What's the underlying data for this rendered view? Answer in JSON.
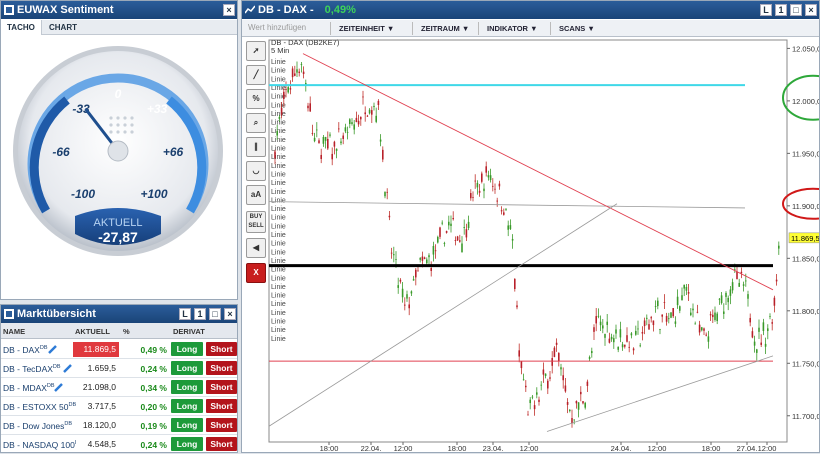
{
  "sentiment": {
    "title": "EUWAX Sentiment",
    "tabs": [
      "TACHO",
      "CHART"
    ],
    "gauge_labels": {
      "zero": "0",
      "m33": "-33",
      "p33": "+33",
      "m66": "-66",
      "p66": "+66",
      "m100": "-100",
      "p100": "+100"
    },
    "aktuell_label": "AKTUELL",
    "aktuell_value": "-27,87",
    "needle_value": -27.87
  },
  "market": {
    "title": "Marktübersicht",
    "headers": {
      "name": "NAME",
      "aktuell": "AKTUELL",
      "pct": "%",
      "derivat": "DERIVAT"
    },
    "long_label": "Long",
    "short_label": "Short",
    "rows": [
      {
        "name": "DB - DAX",
        "sup": "DB",
        "price": "11.869,5",
        "pct": "0,49 %",
        "neg": true
      },
      {
        "name": "DB - TecDAX",
        "sup": "DB",
        "price": "1.659,5",
        "pct": "0,24 %",
        "neg": false
      },
      {
        "name": "DB - MDAX",
        "sup": "DB",
        "price": "21.098,0",
        "pct": "0,34 %",
        "neg": false
      },
      {
        "name": "DB - ESTOXX 50",
        "sup": "DB",
        "price": "3.717,5",
        "pct": "0,20 %",
        "neg": false
      },
      {
        "name": "DB - Dow Jones",
        "sup": "DB",
        "price": "18.120,0",
        "pct": "0,19 %",
        "neg": false
      },
      {
        "name": "DB - NASDAQ 100",
        "sup": "I",
        "price": "4.548,5",
        "pct": "0,24 %",
        "neg": false
      }
    ]
  },
  "chart": {
    "title": "DB - DAX -",
    "change": "0,49%",
    "add_value_placeholder": "Wert hinzufügen",
    "menus": [
      "ZEITEINHEIT",
      "ZEITRAUM",
      "INDIKATOR",
      "SCANS"
    ],
    "symbol": "DB - DAX (DB2KE7)",
    "interval": "5 Min",
    "linie_label": "Linie",
    "tools": [
      "Cursor",
      "Line",
      "%",
      "Zoom",
      "Parallel",
      "Curve",
      "aA",
      "BUY SELL",
      "Sound",
      "X"
    ],
    "current_price": "11.869,5"
  },
  "chart_data": {
    "type": "candlestick",
    "y_ticks": [
      "12.050,0",
      "12.000,0",
      "11.950,0",
      "11.900,0",
      "11.850,0",
      "11.800,0",
      "11.750,0",
      "11.700,0"
    ],
    "ylim": [
      11675,
      12058
    ],
    "x_ticks": [
      "18:00",
      "22.04.",
      "12:00",
      "18:00",
      "23.04.",
      "12:00",
      "24.04.",
      "12:00",
      "18:00",
      "27.04.",
      "12:00"
    ],
    "horizontal_lines": [
      12015,
      11904,
      11843,
      11752
    ],
    "last": 11869.5
  },
  "colors": {
    "accent": "#1a4478",
    "long": "#1d9a3a",
    "short": "#b3141c",
    "cyan": "#3fd8e8",
    "neg": "#e0393e"
  }
}
